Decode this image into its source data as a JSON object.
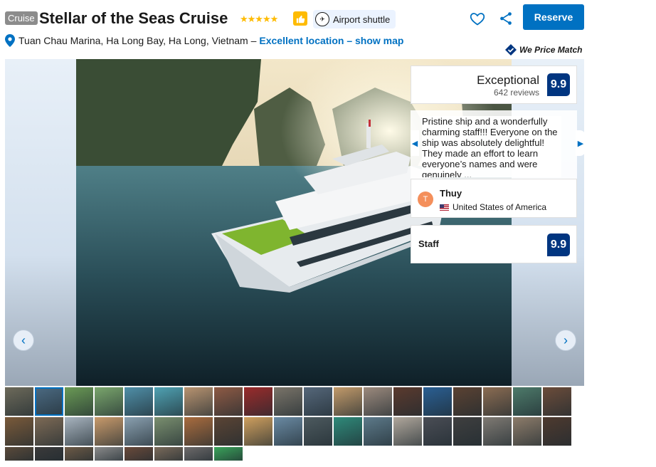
{
  "header": {
    "type_badge": "Cruise",
    "title": "Stellar of the Seas Cruise",
    "stars": "★★★★★",
    "star_count": 5,
    "shuttle_label": "Airport shuttle",
    "reserve_label": "Reserve"
  },
  "address": {
    "text": "Tuan Chau Marina, Ha Long Bay, Ha Long, Vietnam –",
    "link": "Excellent location – show map"
  },
  "price_match": "We Price Match",
  "score": {
    "word": "Exceptional",
    "reviews": "642 reviews",
    "value": "9.9"
  },
  "review": {
    "text": "Pristine ship and a wonderfully charming staff!!! Everyone on the ship was absolutely delightful! They made an effort to learn everyone’s names and were genuinely ...",
    "reviewer_initial": "T",
    "reviewer_name": "Thuy",
    "reviewer_country": "United States of America"
  },
  "staff": {
    "label": "Staff",
    "value": "9.9"
  },
  "gallery": {
    "prev_symbol": "‹",
    "next_symbol": "›",
    "selected_thumb": 1
  },
  "thumbnails": {
    "row1": [
      "#6d6a5a",
      "#4b6a82",
      "#6a9a55",
      "#7aa66c",
      "#4f8fa8",
      "#4fa2b3",
      "#b89370",
      "#8e5a44",
      "#9a2b2b",
      "#7a7469",
      "#55677a",
      "#c29a6a",
      "#9c8a7d",
      "#5b3a2e",
      "#2a5f93",
      "#5b4232",
      "#8b6c52",
      "#4d7a6a",
      "#6b4c3a"
    ],
    "row2": [
      "#7a5a3a",
      "#7d6a55",
      "#a8b4bf",
      "#c89a6b",
      "#8aa0b0",
      "#7a8f6f",
      "#a96c3e",
      "#5b4434",
      "#cf9f5e",
      "#6a8aa3",
      "#4d5a5f",
      "#2f8a7a",
      "#5d7a8a",
      "#b0a79c",
      "#4a4d55",
      "#3f3f3f",
      "#7f7a73",
      "#8d7c6a",
      "#4e3a2f"
    ],
    "row3": [
      "#5a4a3a",
      "#3b3a3a",
      "#6d5a46",
      "#8a8a8a",
      "#6a4a3a",
      "#7a6a5a",
      "#6d6a6a",
      "#3aa35a"
    ]
  }
}
